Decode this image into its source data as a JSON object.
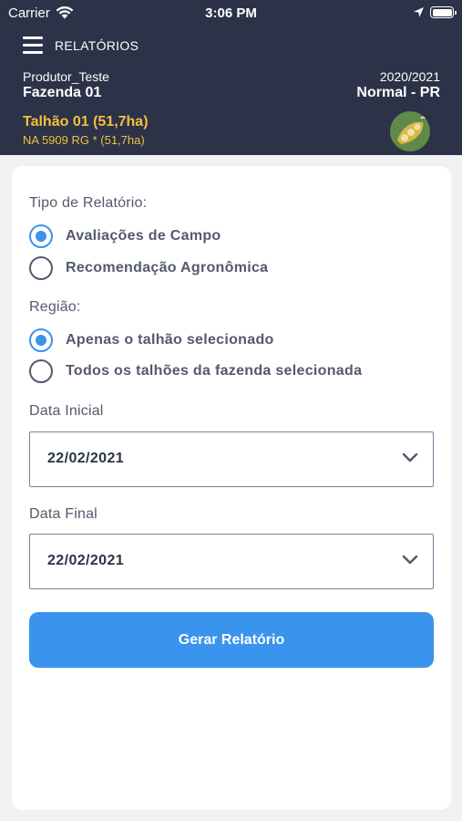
{
  "status_bar": {
    "carrier": "Carrier",
    "time": "3:06 PM"
  },
  "header": {
    "title": "RELATÓRIOS",
    "producer": "Produtor_Teste",
    "farm": "Fazenda 01",
    "season": "2020/2021",
    "region": "Normal - PR",
    "plot": "Talhão 01 (51,7ha)",
    "variety": "NA 5909 RG * (51,7ha)",
    "crop_icon": "soybean-icon"
  },
  "form": {
    "report_type_label": "Tipo de Relatório:",
    "report_types": [
      {
        "label": "Avaliações de Campo",
        "selected": true
      },
      {
        "label": "Recomendação Agronômica",
        "selected": false
      }
    ],
    "region_label": "Região:",
    "regions": [
      {
        "label": "Apenas o talhão selecionado",
        "selected": true
      },
      {
        "label": "Todos os talhões da fazenda selecionada",
        "selected": false
      }
    ],
    "start_date_label": "Data Inicial",
    "start_date_value": "22/02/2021",
    "end_date_label": "Data Final",
    "end_date_value": "22/02/2021",
    "submit_label": "Gerar Relatório"
  },
  "colors": {
    "header_bg": "#2c3248",
    "accent": "#3a93ed",
    "plot_text": "#f0c239"
  }
}
